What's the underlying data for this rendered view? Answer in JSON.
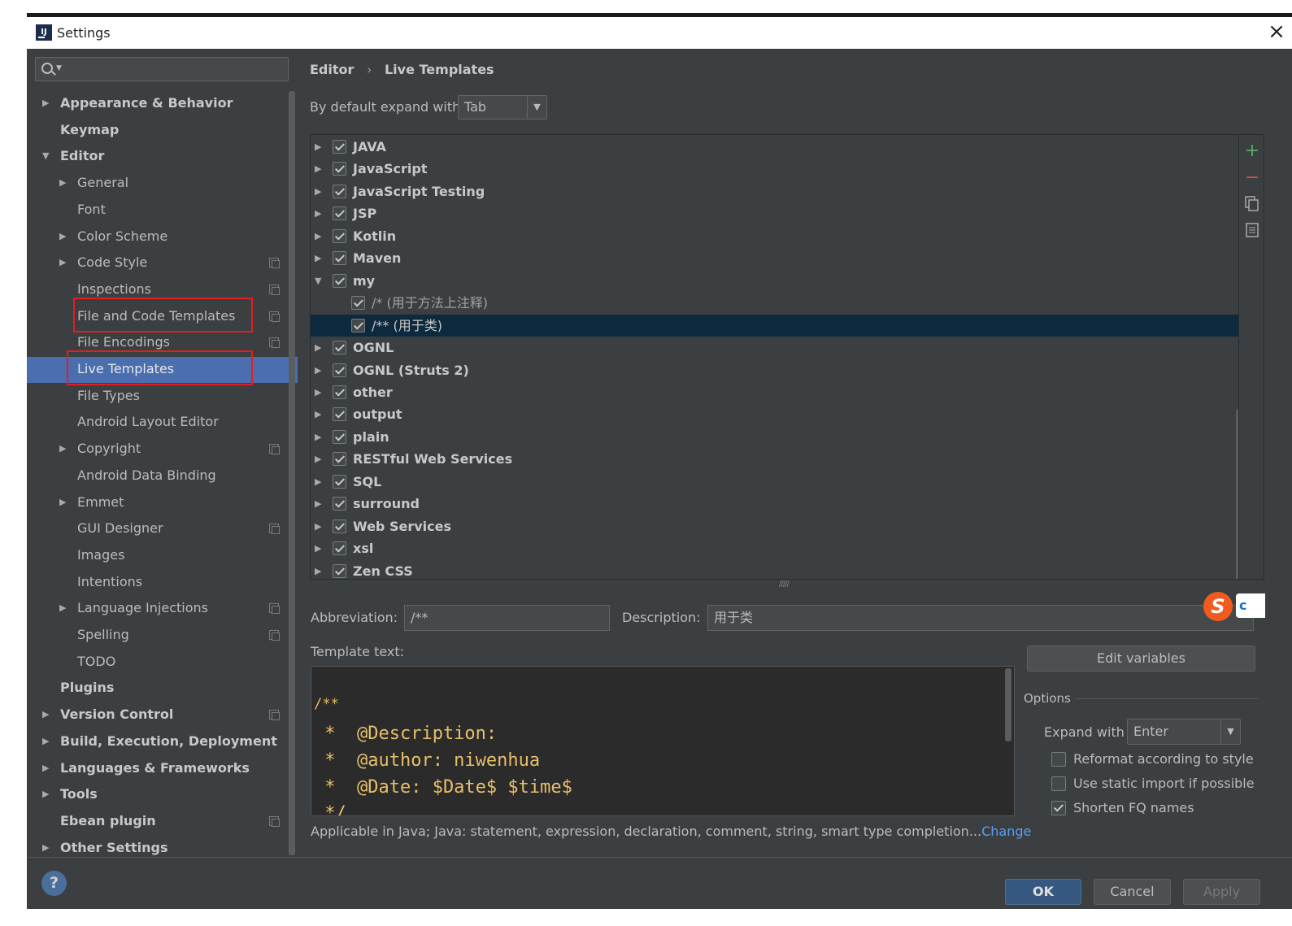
{
  "window": {
    "title": "Settings"
  },
  "sidebar": {
    "search_placeholder": "",
    "items": [
      {
        "label": "Appearance & Behavior",
        "level": 0,
        "arrow": "▶",
        "bold": true
      },
      {
        "label": "Keymap",
        "level": 0,
        "arrow": "",
        "bold": true
      },
      {
        "label": "Editor",
        "level": 0,
        "arrow": "▼",
        "bold": true
      },
      {
        "label": "General",
        "level": 1,
        "arrow": "▶"
      },
      {
        "label": "Font",
        "level": 1,
        "arrow": ""
      },
      {
        "label": "Color Scheme",
        "level": 1,
        "arrow": "▶"
      },
      {
        "label": "Code Style",
        "level": 1,
        "arrow": "▶",
        "icon": true
      },
      {
        "label": "Inspections",
        "level": 1,
        "arrow": "",
        "icon": true
      },
      {
        "label": "File and Code Templates",
        "level": 1,
        "arrow": "",
        "icon": true
      },
      {
        "label": "File Encodings",
        "level": 1,
        "arrow": "",
        "icon": true
      },
      {
        "label": "Live Templates",
        "level": 1,
        "arrow": "",
        "selected": true
      },
      {
        "label": "File Types",
        "level": 1,
        "arrow": ""
      },
      {
        "label": "Android Layout Editor",
        "level": 1,
        "arrow": ""
      },
      {
        "label": "Copyright",
        "level": 1,
        "arrow": "▶",
        "icon": true
      },
      {
        "label": "Android Data Binding",
        "level": 1,
        "arrow": ""
      },
      {
        "label": "Emmet",
        "level": 1,
        "arrow": "▶"
      },
      {
        "label": "GUI Designer",
        "level": 1,
        "arrow": "",
        "icon": true
      },
      {
        "label": "Images",
        "level": 1,
        "arrow": ""
      },
      {
        "label": "Intentions",
        "level": 1,
        "arrow": ""
      },
      {
        "label": "Language Injections",
        "level": 1,
        "arrow": "▶",
        "icon": true
      },
      {
        "label": "Spelling",
        "level": 1,
        "arrow": "",
        "icon": true
      },
      {
        "label": "TODO",
        "level": 1,
        "arrow": ""
      },
      {
        "label": "Plugins",
        "level": 0,
        "arrow": "",
        "bold": true
      },
      {
        "label": "Version Control",
        "level": 0,
        "arrow": "▶",
        "bold": true,
        "icon": true
      },
      {
        "label": "Build, Execution, Deployment",
        "level": 0,
        "arrow": "▶",
        "bold": true
      },
      {
        "label": "Languages & Frameworks",
        "level": 0,
        "arrow": "▶",
        "bold": true
      },
      {
        "label": "Tools",
        "level": 0,
        "arrow": "▶",
        "bold": true
      },
      {
        "label": "Ebean plugin",
        "level": 0,
        "arrow": "",
        "bold": true,
        "icon": true
      },
      {
        "label": "Other Settings",
        "level": 0,
        "arrow": "▶",
        "bold": true
      }
    ]
  },
  "breadcrumb": {
    "parent": "Editor",
    "separator": "›",
    "current": "Live Templates"
  },
  "expand_default": {
    "label": "By default expand with",
    "value": "Tab"
  },
  "templates": [
    {
      "label": "JAVA",
      "arrow": "▶",
      "checked": true
    },
    {
      "label": "JavaScript",
      "arrow": "▶",
      "checked": true
    },
    {
      "label": "JavaScript Testing",
      "arrow": "▶",
      "checked": true
    },
    {
      "label": "JSP",
      "arrow": "▶",
      "checked": true
    },
    {
      "label": "Kotlin",
      "arrow": "▶",
      "checked": true
    },
    {
      "label": "Maven",
      "arrow": "▶",
      "checked": true
    },
    {
      "label": "my",
      "arrow": "▼",
      "checked": true
    },
    {
      "label": "/* (用于方法上注释)",
      "arrow": "",
      "checked": true,
      "child": true
    },
    {
      "label": "/** (用于类)",
      "arrow": "",
      "checked": true,
      "child": true,
      "selected": true
    },
    {
      "label": "OGNL",
      "arrow": "▶",
      "checked": true
    },
    {
      "label": "OGNL (Struts 2)",
      "arrow": "▶",
      "checked": true
    },
    {
      "label": "other",
      "arrow": "▶",
      "checked": true
    },
    {
      "label": "output",
      "arrow": "▶",
      "checked": true
    },
    {
      "label": "plain",
      "arrow": "▶",
      "checked": true
    },
    {
      "label": "RESTful Web Services",
      "arrow": "▶",
      "checked": true
    },
    {
      "label": "SQL",
      "arrow": "▶",
      "checked": true
    },
    {
      "label": "surround",
      "arrow": "▶",
      "checked": true
    },
    {
      "label": "Web Services",
      "arrow": "▶",
      "checked": true
    },
    {
      "label": "xsl",
      "arrow": "▶",
      "checked": true
    },
    {
      "label": "Zen CSS",
      "arrow": "▶",
      "checked": true
    }
  ],
  "toolbar": {
    "add": "+",
    "remove": "−"
  },
  "colors": {
    "add": "#59a869",
    "remove": "#c75450",
    "selection": "#4b6eaf",
    "highlight_box": "#e02020"
  },
  "abbreviation": {
    "label": "Abbreviation:",
    "value": "/**"
  },
  "description": {
    "label": "Description:",
    "value": "用于类"
  },
  "template_text": {
    "label": "Template text:",
    "lines": [
      "/**",
      " *  @Description:",
      " *  @author: niwenhua",
      " *  @Date: $Date$ $time$",
      " */"
    ]
  },
  "edit_variables_label": "Edit variables",
  "options": {
    "title": "Options",
    "expand_label": "Expand with",
    "expand_value": "Enter",
    "reformat": {
      "label": "Reformat according to style",
      "checked": false
    },
    "static_import": {
      "label": "Use static import if possible",
      "checked": false
    },
    "shorten_fq": {
      "label": "Shorten FQ names",
      "checked": true
    }
  },
  "applicable": {
    "text": "Applicable in Java; Java: statement, expression, declaration, comment, string, smart type completion...",
    "link": "Change"
  },
  "buttons": {
    "ok": "OK",
    "cancel": "Cancel",
    "apply": "Apply",
    "help": "?"
  },
  "ime": {
    "logo": "S",
    "side": "c"
  }
}
